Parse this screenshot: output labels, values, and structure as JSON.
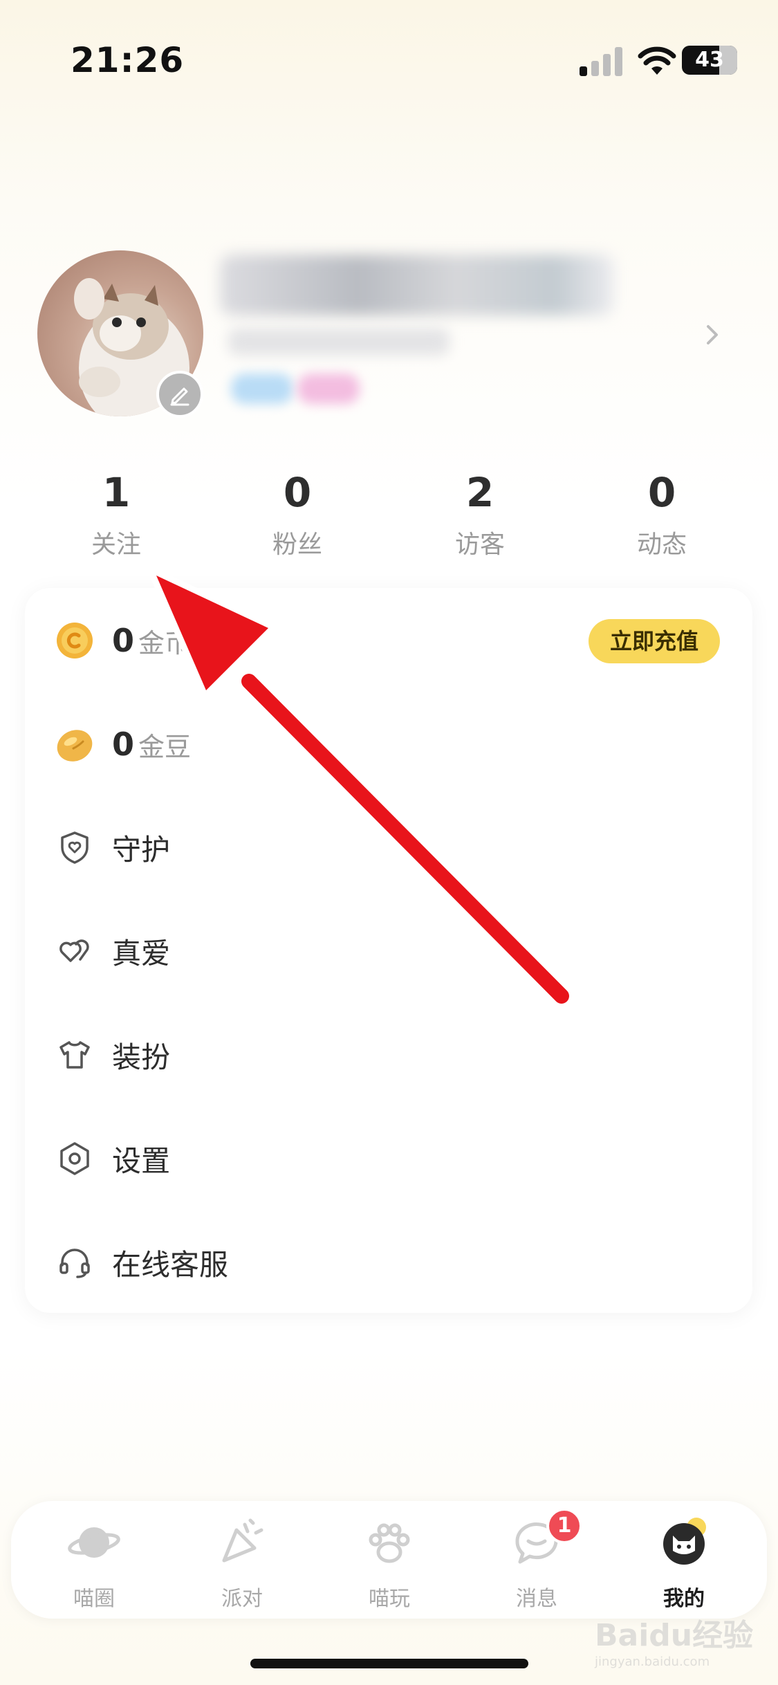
{
  "status_bar": {
    "time": "21:26",
    "battery": "43"
  },
  "stats": [
    {
      "value": "1",
      "label": "关注"
    },
    {
      "value": "0",
      "label": "粉丝"
    },
    {
      "value": "2",
      "label": "访客"
    },
    {
      "value": "0",
      "label": "动态"
    }
  ],
  "wallet": {
    "coins": {
      "value": "0",
      "unit": "金币"
    },
    "beans": {
      "value": "0",
      "unit": "金豆"
    },
    "recharge_label": "立即充值"
  },
  "menu": [
    {
      "label": "守护",
      "icon": "shield-icon"
    },
    {
      "label": "真爱",
      "icon": "hearts-icon"
    },
    {
      "label": "装扮",
      "icon": "shirt-icon"
    },
    {
      "label": "设置",
      "icon": "gear-icon"
    },
    {
      "label": "在线客服",
      "icon": "headset-icon"
    }
  ],
  "tabs": [
    {
      "label": "喵圈",
      "icon": "planet-icon"
    },
    {
      "label": "派对",
      "icon": "party-popper-icon"
    },
    {
      "label": "喵玩",
      "icon": "paw-icon"
    },
    {
      "label": "消息",
      "icon": "chat-bubble-icon",
      "badge": "1"
    },
    {
      "label": "我的",
      "icon": "cat-face-icon",
      "active": true
    }
  ],
  "watermark": {
    "brand": "Baidu经验",
    "url": "jingyan.baidu.com"
  },
  "colors": {
    "accent_yellow": "#f8d75a",
    "badge_red": "#ef4b55",
    "arrow_red": "#e8141b"
  }
}
